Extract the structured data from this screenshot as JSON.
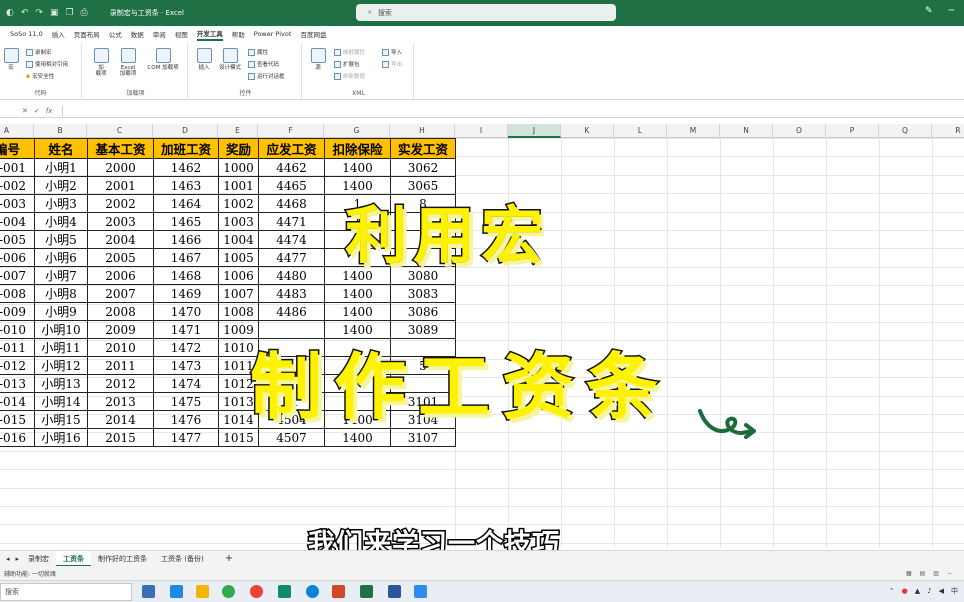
{
  "titlebar": {
    "title": "录制宏与工资条 · Excel",
    "search_placeholder": "搜索",
    "qa_icons": [
      "autosave-icon",
      "undo-icon",
      "redo-icon",
      "save-icon",
      "copy-icon",
      "print-icon"
    ]
  },
  "menu": [
    "SoSo 11.0",
    "插入",
    "页面布局",
    "公式",
    "数据",
    "审阅",
    "视图",
    "开发工具",
    "帮助",
    "Power Pivot",
    "百度网盘"
  ],
  "menu_active_index": 7,
  "ribbon": {
    "code_group": {
      "label": "代码",
      "macro_btn": "宏",
      "record": "录制宏",
      "relative": "使用相对引用",
      "security": "宏安全性"
    },
    "addins_group": {
      "label": "加载项",
      "addin": "加\n载项",
      "excel_addin": "Excel\n加载项",
      "com_addin": "COM 加载项"
    },
    "controls_group": {
      "label": "控件",
      "insert": "插入",
      "design": "设计模式",
      "properties": "属性",
      "view_code": "查看代码",
      "run_dialog": "运行对话框"
    },
    "xml_group": {
      "label": "XML",
      "source": "源",
      "map_props": "映射属性",
      "expansion": "扩展包",
      "refresh": "刷新数据",
      "import": "导入",
      "export": "导出"
    }
  },
  "formula_bar": {
    "fx": "fx"
  },
  "columns": [
    "A",
    "B",
    "C",
    "D",
    "E",
    "F",
    "G",
    "H",
    "I",
    "J",
    "K",
    "L",
    "M",
    "N",
    "O",
    "P",
    "Q",
    "R"
  ],
  "selected_column": "J",
  "table": {
    "headers": [
      "编号",
      "姓名",
      "基本工资",
      "加班工资",
      "奖励",
      "应发工资",
      "扣除保险",
      "实发工资"
    ],
    "rows": [
      [
        "-001",
        "小明1",
        "2000",
        "1462",
        "1000",
        "4462",
        "1400",
        "3062"
      ],
      [
        "-002",
        "小明2",
        "2001",
        "1463",
        "1001",
        "4465",
        "1400",
        "3065"
      ],
      [
        "-003",
        "小明3",
        "2002",
        "1464",
        "1002",
        "4468",
        "1",
        "8"
      ],
      [
        "-004",
        "小明4",
        "2003",
        "1465",
        "1003",
        "4471",
        "1",
        ""
      ],
      [
        "-005",
        "小明5",
        "2004",
        "1466",
        "1004",
        "4474",
        "",
        ""
      ],
      [
        "-006",
        "小明6",
        "2005",
        "1467",
        "1005",
        "4477",
        "",
        ""
      ],
      [
        "-007",
        "小明7",
        "2006",
        "1468",
        "1006",
        "4480",
        "1400",
        "3080"
      ],
      [
        "-008",
        "小明8",
        "2007",
        "1469",
        "1007",
        "4483",
        "1400",
        "3083"
      ],
      [
        "-009",
        "小明9",
        "2008",
        "1470",
        "1008",
        "4486",
        "1400",
        "3086"
      ],
      [
        "-010",
        "小明10",
        "2009",
        "1471",
        "1009",
        "",
        "1400",
        "3089"
      ],
      [
        "-011",
        "小明11",
        "2010",
        "1472",
        "1010",
        "",
        "",
        ""
      ],
      [
        "-012",
        "小明12",
        "2011",
        "1473",
        "1011",
        "",
        "1",
        "5"
      ],
      [
        "-013",
        "小明13",
        "2012",
        "1474",
        "1012",
        "",
        "",
        ""
      ],
      [
        "-014",
        "小明14",
        "2013",
        "1475",
        "1013",
        "01",
        "",
        "3101"
      ],
      [
        "-015",
        "小明15",
        "2014",
        "1476",
        "1014",
        "4504",
        "1400",
        "3104"
      ],
      [
        "-016",
        "小明16",
        "2015",
        "1477",
        "1015",
        "4507",
        "1400",
        "3107"
      ]
    ]
  },
  "overlay": {
    "line1": "利用宏",
    "line2": "制作工资条",
    "subtitle": "我们来学习一个技巧"
  },
  "sheets": [
    "录制宏",
    "工资条",
    "制作好的工资条",
    "工资条 (备份)"
  ],
  "active_sheet_index": 1,
  "add_sheet": "+",
  "status": {
    "text": "辅助功能: 一切就绪"
  },
  "taskbar": {
    "search": "搜索",
    "ime": "中"
  },
  "colors": {
    "excel_green": "#1f7145",
    "header_fill": "#ffc000",
    "overlay_text": "#fff200"
  }
}
